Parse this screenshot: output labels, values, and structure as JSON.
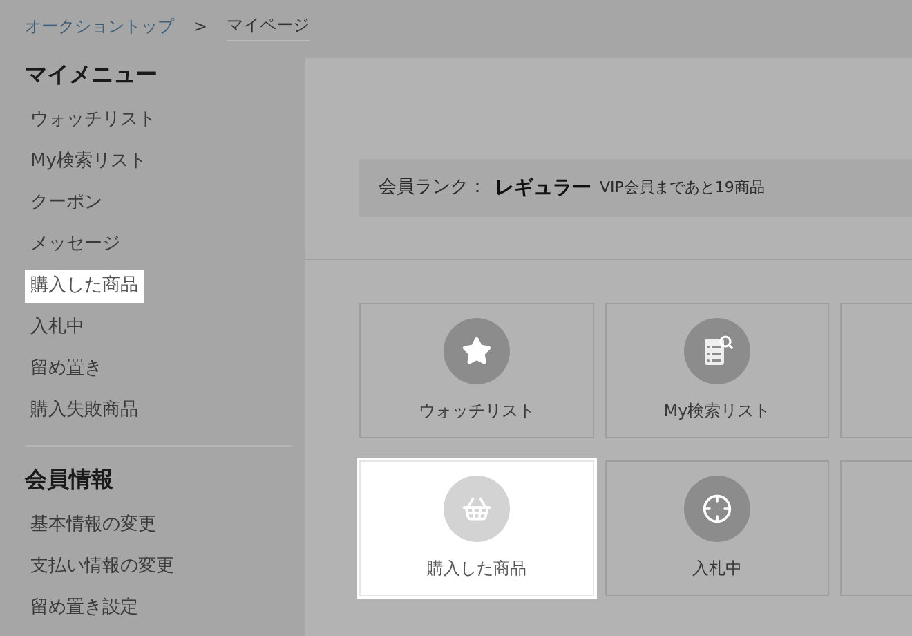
{
  "breadcrumb": [
    {
      "label": "オークショントップ",
      "current": false
    },
    {
      "label": "マイページ",
      "current": true
    }
  ],
  "breadcrumb_separator": ">",
  "sidebar": {
    "sections": [
      {
        "title": "マイメニュー",
        "items": [
          {
            "label": "ウォッチリスト",
            "highlighted": false
          },
          {
            "label": "My検索リスト",
            "highlighted": false
          },
          {
            "label": "クーポン",
            "highlighted": false
          },
          {
            "label": "メッセージ",
            "highlighted": false
          },
          {
            "label": "購入した商品",
            "highlighted": true
          },
          {
            "label": "入札中",
            "highlighted": false
          },
          {
            "label": "留め置き",
            "highlighted": false
          },
          {
            "label": "購入失敗商品",
            "highlighted": false
          }
        ]
      },
      {
        "title": "会員情報",
        "items": [
          {
            "label": "基本情報の変更",
            "highlighted": false
          },
          {
            "label": "支払い情報の変更",
            "highlighted": false
          },
          {
            "label": "留め置き設定",
            "highlighted": false
          }
        ]
      }
    ]
  },
  "member_rank": {
    "label": "会員ランク：",
    "rank": "レギュラー",
    "note": "VIP会員まであと19商品"
  },
  "cards": [
    {
      "label": "ウォッチリスト",
      "kind": "star",
      "highlighted": false
    },
    {
      "label": "My検索リスト",
      "kind": "search-list",
      "highlighted": false
    },
    {
      "kind": "blank",
      "highlighted": false
    },
    {
      "label": "購入した商品",
      "kind": "basket",
      "highlighted": true
    },
    {
      "label": "入札中",
      "kind": "crosshair",
      "highlighted": false
    },
    {
      "kind": "blank",
      "highlighted": false
    }
  ]
}
